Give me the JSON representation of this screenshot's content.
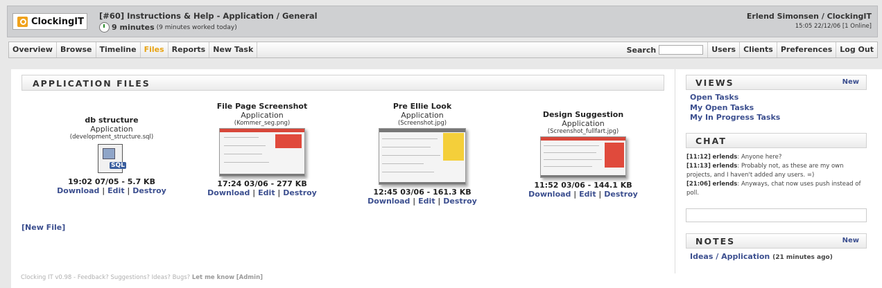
{
  "app": {
    "logo_text": "ClockingIT"
  },
  "header": {
    "task_title": "[#60] Instructions & Help - Application / General",
    "worked_main": "9 minutes",
    "worked_detail": "(9 minutes worked today)",
    "user": "Erlend Simonsen / ClockingIT",
    "time_status": "15:05 22/12/06 [1 Online]"
  },
  "nav": {
    "left": [
      "Overview",
      "Browse",
      "Timeline",
      "Files",
      "Reports",
      "New Task"
    ],
    "active": "Files",
    "search_label": "Search",
    "search_value": "",
    "right": [
      "Users",
      "Clients",
      "Preferences",
      "Log Out"
    ]
  },
  "main": {
    "title": "APPLICATION FILES",
    "files": [
      {
        "name": "db structure",
        "project": "Application",
        "original": "(development_structure.sql)",
        "meta": "19:02 07/05 - 5.7 KB",
        "icon": "sql-file-icon"
      },
      {
        "name": "File Page Screenshot",
        "project": "Application",
        "original": "(Kommer_seg.png)",
        "meta": "17:24 03/06 - 277 KB",
        "icon": "screenshot-thumbnail"
      },
      {
        "name": "Pre Ellie Look",
        "project": "Application",
        "original": "(Screenshot.jpg)",
        "meta": "12:45 03/06 - 161.3 KB",
        "icon": "screenshot-thumbnail"
      },
      {
        "name": "Design Suggestion",
        "project": "Application",
        "original": "(Screenshot_fullfart.jpg)",
        "meta": "11:52 03/06 - 144.1 KB",
        "icon": "screenshot-thumbnail"
      }
    ],
    "actions": {
      "download": "Download",
      "edit": "Edit",
      "destroy": "Destroy",
      "sep": "|"
    },
    "new_file": "[New File]"
  },
  "footer": {
    "text": "Clocking IT v0.98 - Feedback? Suggestions? Ideas? Bugs?",
    "link": "Let me know",
    "admin": "[Admin]"
  },
  "sidebar": {
    "views": {
      "title": "VIEWS",
      "new": "New",
      "items": [
        "Open Tasks",
        "My Open Tasks",
        "My In Progress Tasks"
      ]
    },
    "chat": {
      "title": "CHAT",
      "messages": [
        {
          "time": "[11:12]",
          "user": "erlends",
          "text": ": Anyone here?"
        },
        {
          "time": "[11:13]",
          "user": "erlends",
          "text": ": Probably not, as these are my own projects, and I haven't added any users. =)"
        },
        {
          "time": "[21:06]",
          "user": "erlends",
          "text": ": Anyways, chat now uses push instead of poll."
        }
      ]
    },
    "notes": {
      "title": "NOTES",
      "new": "New",
      "item": "Ideas / Application",
      "item_age": "(21 minutes ago)"
    }
  },
  "colors": {
    "accent": "#e8a313",
    "link": "#3c4f8f",
    "header_bg": "#cfd0d2"
  }
}
